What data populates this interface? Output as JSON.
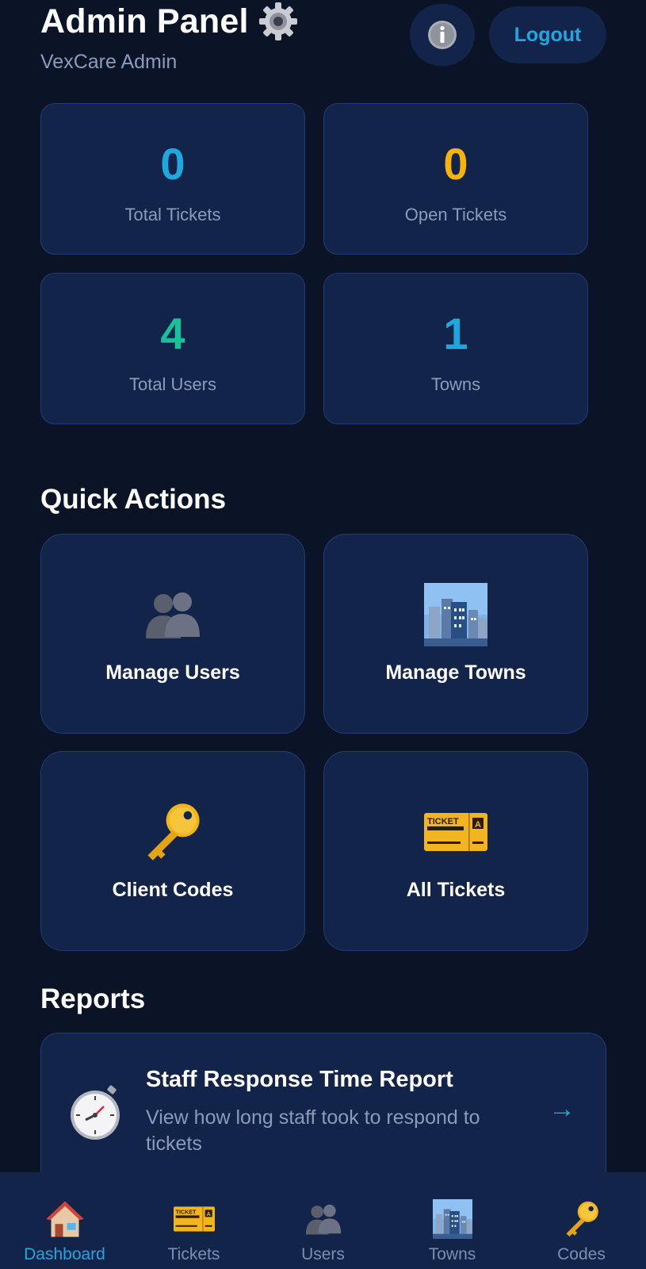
{
  "header": {
    "title": "Admin Panel",
    "subtitle": "VexCare Admin",
    "info_icon": "info-icon",
    "logout_label": "Logout"
  },
  "stats": [
    {
      "value": "0",
      "label": "Total Tickets",
      "color": "#1ea8df"
    },
    {
      "value": "0",
      "label": "Open Tickets",
      "color": "#f5b30b"
    },
    {
      "value": "4",
      "label": "Total Users",
      "color": "#16c29a"
    },
    {
      "value": "1",
      "label": "Towns",
      "color": "#1ea8df"
    }
  ],
  "quick_actions": {
    "title": "Quick Actions",
    "items": [
      {
        "label": "Manage Users",
        "icon": "users-icon"
      },
      {
        "label": "Manage Towns",
        "icon": "city-icon"
      },
      {
        "label": "Client Codes",
        "icon": "key-icon"
      },
      {
        "label": "All Tickets",
        "icon": "ticket-icon"
      }
    ]
  },
  "reports": {
    "title": "Reports",
    "items": [
      {
        "title": "Staff Response Time Report",
        "description": "View how long staff took to respond to tickets",
        "icon": "stopwatch-icon",
        "arrow": "→"
      }
    ]
  },
  "bottom_nav": {
    "items": [
      {
        "label": "Dashboard",
        "icon": "home-icon",
        "active": true
      },
      {
        "label": "Tickets",
        "icon": "ticket-icon",
        "active": false
      },
      {
        "label": "Users",
        "icon": "users-icon",
        "active": false
      },
      {
        "label": "Towns",
        "icon": "city-icon",
        "active": false
      },
      {
        "label": "Codes",
        "icon": "key-icon",
        "active": false
      }
    ]
  },
  "colors": {
    "background": "#0b1427",
    "card": "#13244a",
    "accent": "#1ea8df"
  }
}
